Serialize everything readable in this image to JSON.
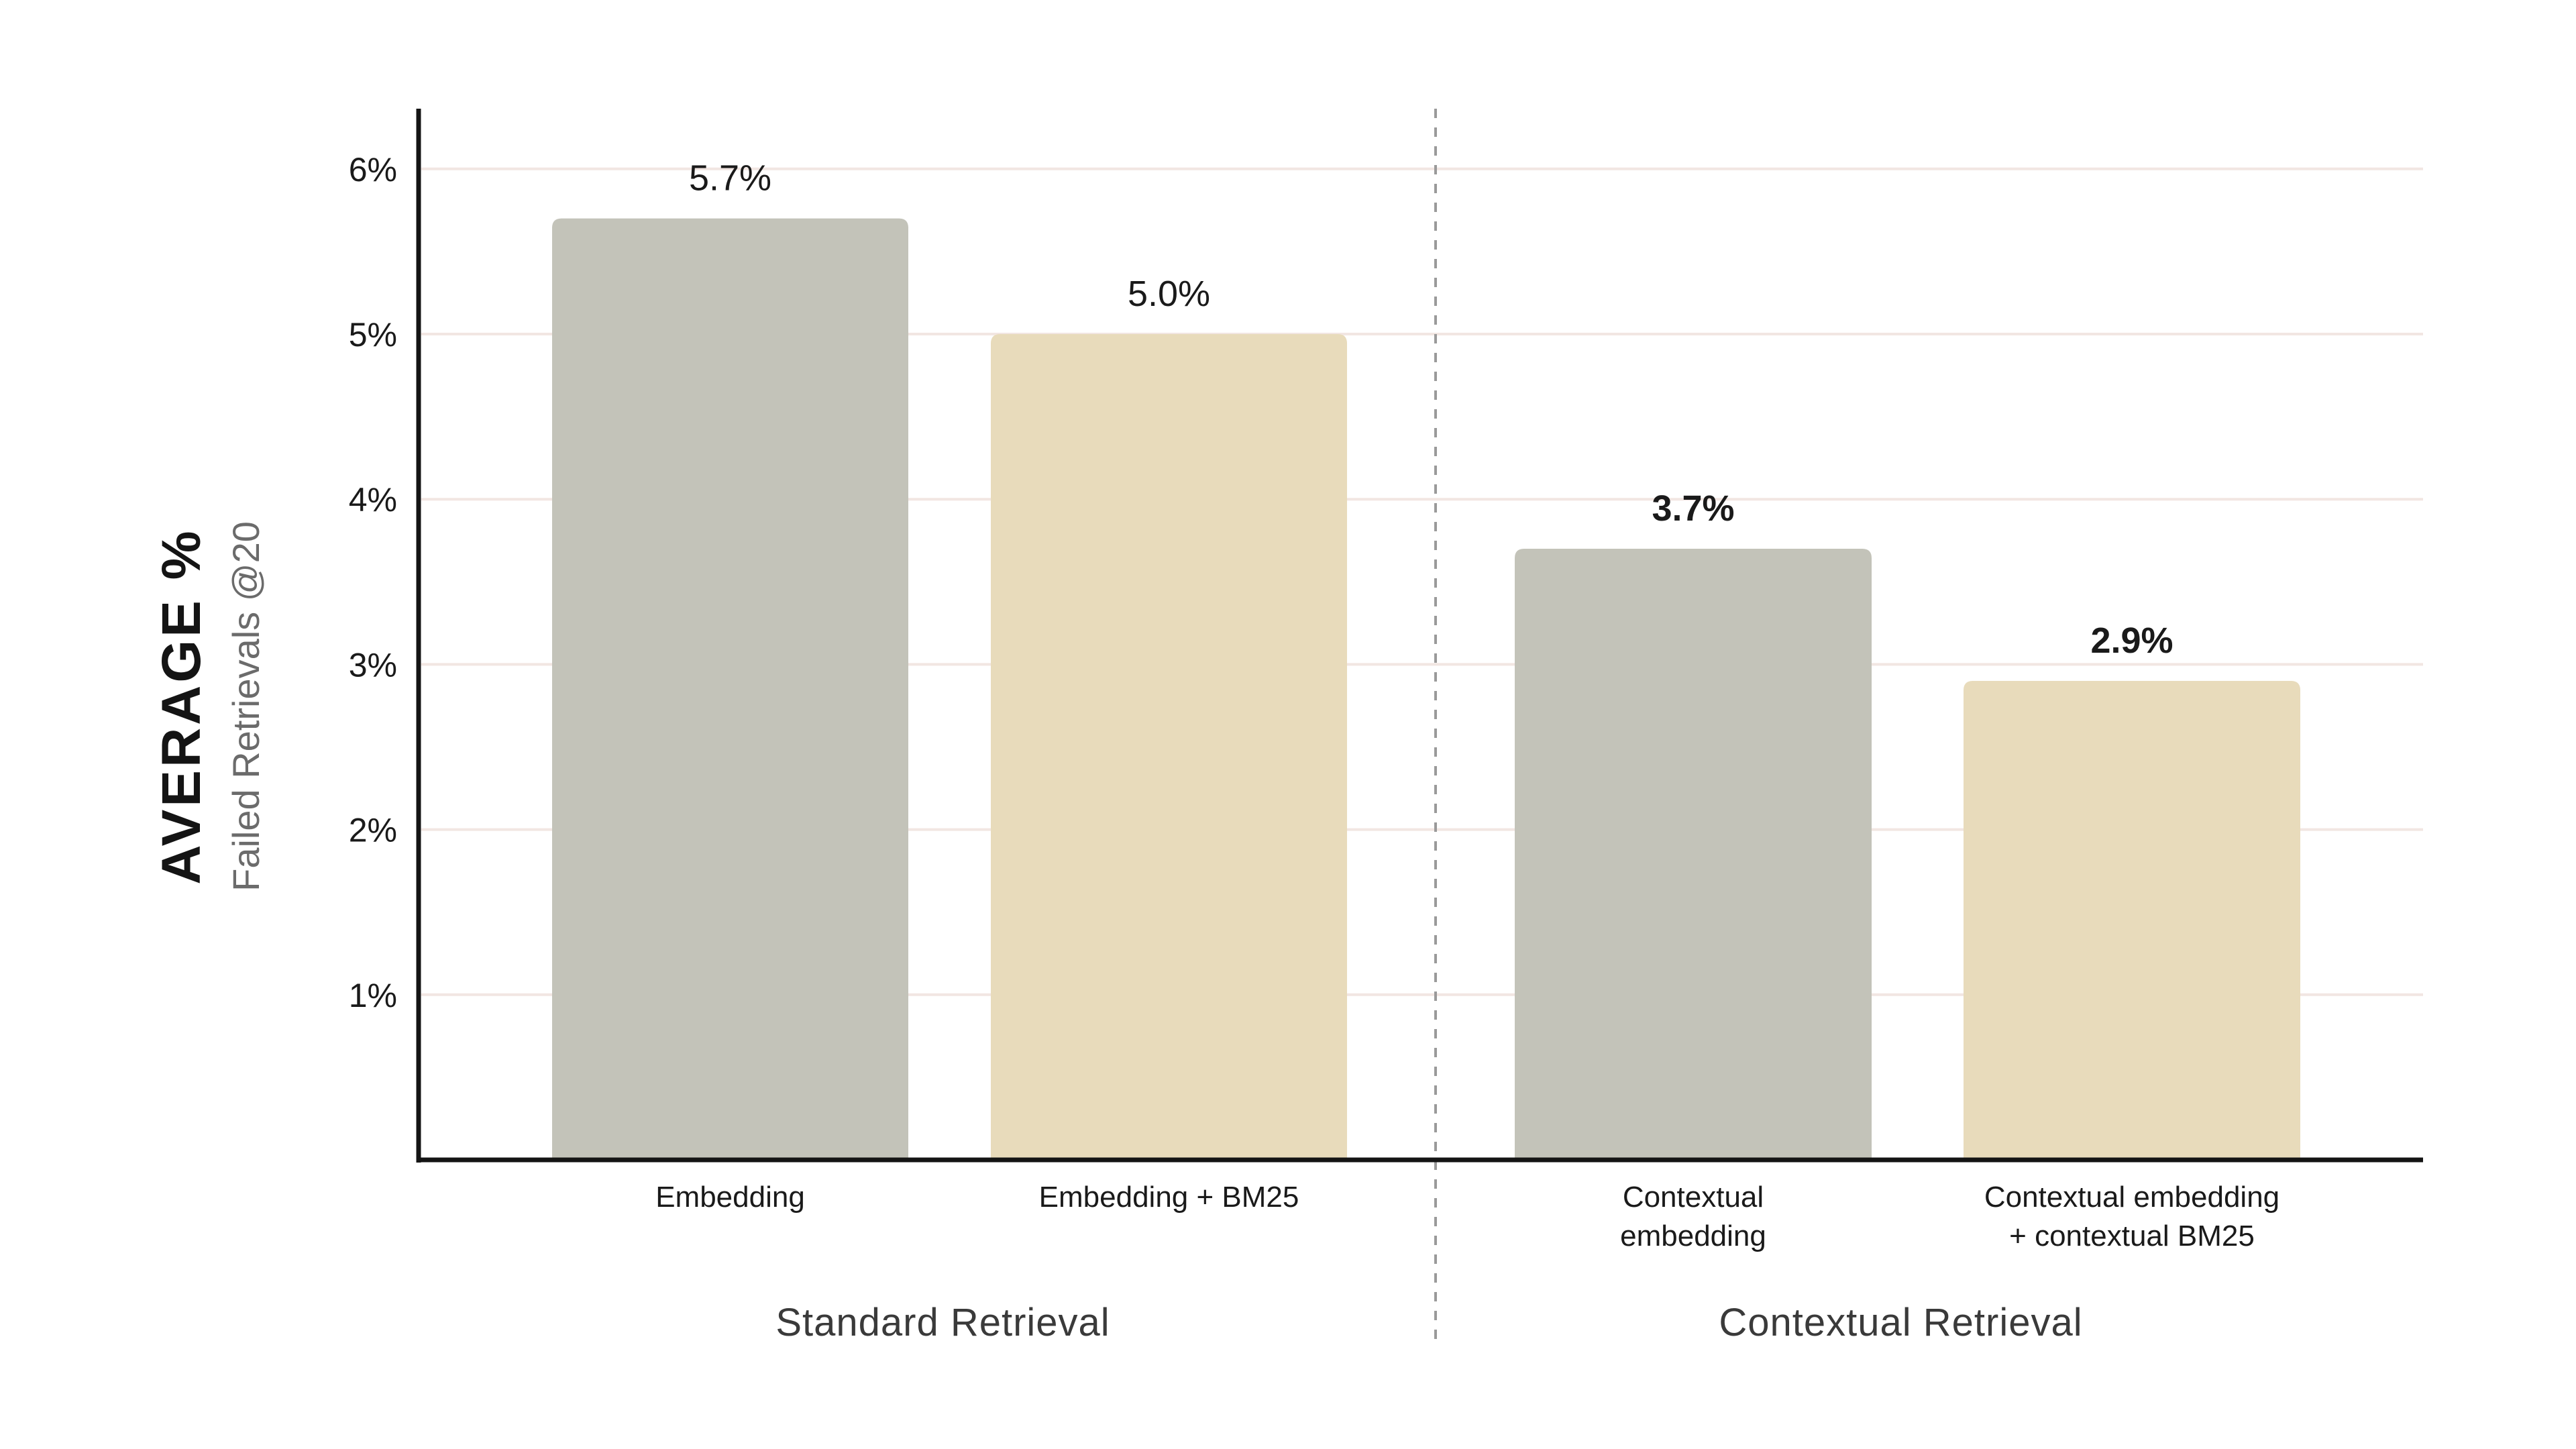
{
  "chart_data": {
    "type": "bar",
    "title": "",
    "ylabel": "AVERAGE %",
    "ylabel_sub": "Failed Retrievals @20",
    "xlabel": "",
    "ylim": [
      0,
      6.4
    ],
    "yticks": [
      1,
      2,
      3,
      4,
      5,
      6
    ],
    "ytick_labels": [
      "1%",
      "2%",
      "3%",
      "4%",
      "5%",
      "6%"
    ],
    "grid": "horizontal",
    "categories": [
      [
        "Embedding"
      ],
      [
        "Embedding + BM25"
      ],
      [
        "Contextual",
        "embedding"
      ],
      [
        "Contextual embedding",
        "+ contextual BM25"
      ]
    ],
    "values": [
      5.7,
      5.0,
      3.7,
      2.9
    ],
    "value_labels": [
      "5.7%",
      "5.0%",
      "3.7%",
      "2.9%"
    ],
    "value_label_bold": [
      false,
      false,
      true,
      true
    ],
    "bar_colors": [
      "#C3C3B9",
      "#E8DBBB",
      "#C3C3B9",
      "#E8DBBB"
    ],
    "groups": [
      {
        "label": "Standard Retrieval",
        "members": [
          0,
          1
        ]
      },
      {
        "label": "Contextual Retrieval",
        "members": [
          2,
          3
        ]
      }
    ],
    "colors": {
      "grid": "#F2E6E2",
      "axis": "#141414",
      "divider": "#9a9a9a"
    }
  }
}
